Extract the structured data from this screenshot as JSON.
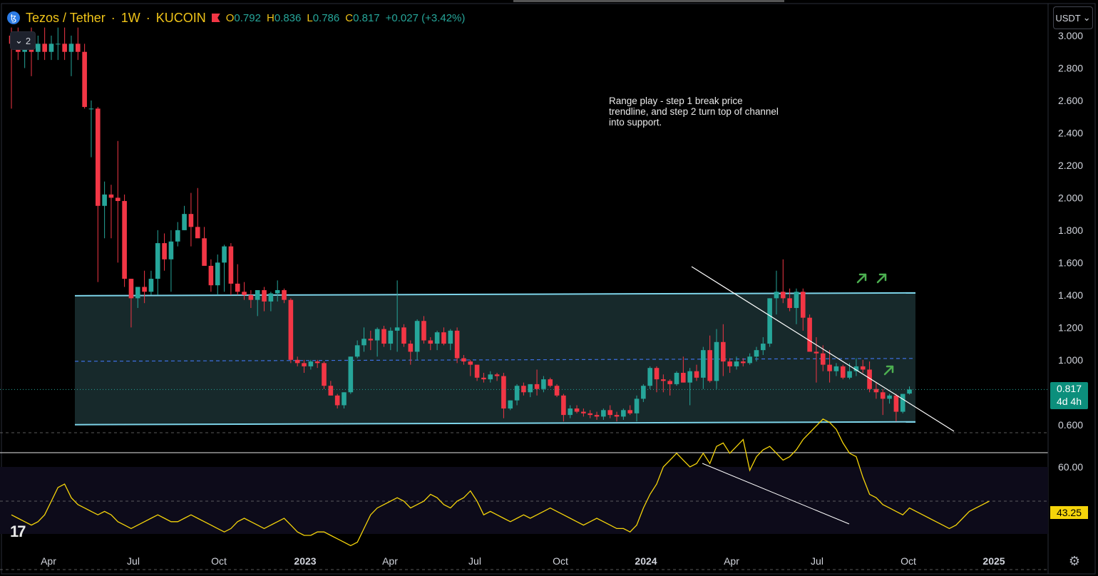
{
  "legend": {
    "symbol": "Tezos / Tether",
    "sep": "·",
    "interval": "1W",
    "exchange": "KUCOIN",
    "o_label": "O",
    "o": "0.792",
    "h_label": "H",
    "h": "0.836",
    "l_label": "L",
    "l": "0.786",
    "c_label": "C",
    "c": "0.817",
    "change": "+0.027 (+3.42%)",
    "collapsed_count": "2"
  },
  "currency": "USDT",
  "last_price": "0.817",
  "countdown": "4d 4h",
  "rsi_value": "43.25",
  "annotation": "Range play - step 1 break price trendline, and step 2 turn top of channel into support.",
  "colors": {
    "up": "#26a69a",
    "down": "#f23645",
    "channel": "#7dd3e8",
    "midline": "#3d6fe0",
    "rsi": "#f5d40a",
    "arrow": "#4caf50"
  },
  "icons": [
    "tezos-logo-icon",
    "flag-icon",
    "chevron-down-icon",
    "tradingview-logo-icon",
    "gear-icon",
    "arrow-up-right-icon"
  ],
  "chart_data": {
    "type": "candlestick",
    "price_axis": {
      "ticks": [
        "3.000",
        "2.800",
        "2.600",
        "2.400",
        "2.200",
        "2.000",
        "1.800",
        "1.600",
        "1.400",
        "1.200",
        "1.000",
        "0.600"
      ],
      "range": [
        0.52,
        3.06
      ]
    },
    "time_axis": {
      "labels": [
        "Apr",
        "Jul",
        "Oct",
        "2023",
        "Apr",
        "Jul",
        "Oct",
        "2024",
        "Apr",
        "Jul",
        "Oct",
        "2025"
      ],
      "start": "2022-01-03",
      "interval_days": 7
    },
    "ohlc": [
      [
        3.0,
        3.05,
        2.55,
        2.95
      ],
      [
        2.95,
        3.05,
        2.85,
        2.9
      ],
      [
        2.9,
        3.0,
        2.8,
        2.95
      ],
      [
        2.95,
        3.05,
        2.75,
        2.9
      ],
      [
        2.9,
        3.0,
        2.85,
        2.95
      ],
      [
        2.95,
        3.05,
        2.85,
        2.9
      ],
      [
        2.9,
        3.0,
        2.85,
        2.95
      ],
      [
        2.95,
        3.05,
        2.85,
        2.95
      ],
      [
        2.95,
        3.05,
        2.85,
        2.9
      ],
      [
        2.9,
        3.0,
        2.75,
        2.95
      ],
      [
        2.95,
        3.05,
        2.85,
        2.9
      ],
      [
        2.9,
        2.95,
        2.55,
        2.56
      ],
      [
        2.55,
        2.6,
        2.25,
        2.55
      ],
      [
        2.55,
        2.56,
        1.48,
        1.95
      ],
      [
        1.95,
        2.1,
        1.75,
        2.02
      ],
      [
        2.02,
        2.08,
        1.75,
        2.0
      ],
      [
        2.0,
        2.35,
        1.6,
        1.98
      ],
      [
        1.98,
        2.02,
        1.45,
        1.5
      ],
      [
        1.5,
        1.5,
        1.2,
        1.38
      ],
      [
        1.38,
        1.45,
        1.32,
        1.45
      ],
      [
        1.45,
        1.55,
        1.35,
        1.42
      ],
      [
        1.42,
        1.55,
        1.4,
        1.5
      ],
      [
        1.5,
        1.8,
        1.4,
        1.72
      ],
      [
        1.72,
        1.78,
        1.55,
        1.62
      ],
      [
        1.62,
        1.8,
        1.42,
        1.73
      ],
      [
        1.73,
        1.85,
        1.7,
        1.8
      ],
      [
        1.8,
        1.95,
        1.8,
        1.9
      ],
      [
        1.9,
        2.03,
        1.7,
        1.82
      ],
      [
        1.82,
        2.06,
        1.76,
        1.75
      ],
      [
        1.75,
        1.82,
        1.6,
        1.58
      ],
      [
        1.58,
        1.62,
        1.42,
        1.46
      ],
      [
        1.46,
        1.65,
        1.4,
        1.6
      ],
      [
        1.6,
        1.71,
        1.42,
        1.7
      ],
      [
        1.7,
        1.72,
        1.4,
        1.47
      ],
      [
        1.47,
        1.59,
        1.4,
        1.42
      ],
      [
        1.42,
        1.48,
        1.37,
        1.4
      ],
      [
        1.4,
        1.43,
        1.32,
        1.37
      ],
      [
        1.37,
        1.42,
        1.27,
        1.43
      ],
      [
        1.43,
        1.45,
        1.3,
        1.36
      ],
      [
        1.36,
        1.42,
        1.3,
        1.41
      ],
      [
        1.41,
        1.49,
        1.36,
        1.43
      ],
      [
        1.43,
        1.44,
        1.35,
        1.37
      ],
      [
        1.37,
        1.38,
        0.98,
        1.0
      ],
      [
        1.0,
        1.02,
        0.96,
        0.98
      ],
      [
        0.98,
        1.0,
        0.92,
        0.96
      ],
      [
        0.96,
        1.0,
        0.94,
        0.99
      ],
      [
        0.99,
        1.0,
        0.95,
        0.98
      ],
      [
        0.98,
        0.99,
        0.82,
        0.84
      ],
      [
        0.84,
        0.87,
        0.78,
        0.78
      ],
      [
        0.78,
        0.79,
        0.7,
        0.72
      ],
      [
        0.72,
        0.8,
        0.7,
        0.8
      ],
      [
        0.8,
        1.02,
        0.79,
        1.02
      ],
      [
        1.02,
        1.12,
        1.01,
        1.09
      ],
      [
        1.09,
        1.2,
        1.05,
        1.13
      ],
      [
        1.13,
        1.18,
        1.06,
        1.12
      ],
      [
        1.12,
        1.2,
        1.02,
        1.19
      ],
      [
        1.19,
        1.21,
        1.08,
        1.1
      ],
      [
        1.1,
        1.2,
        1.06,
        1.18
      ],
      [
        1.18,
        1.49,
        1.05,
        1.2
      ],
      [
        1.2,
        1.22,
        1.08,
        1.1
      ],
      [
        1.1,
        1.12,
        0.97,
        1.05
      ],
      [
        1.05,
        1.25,
        1.0,
        1.24
      ],
      [
        1.24,
        1.27,
        1.1,
        1.12
      ],
      [
        1.12,
        1.14,
        1.06,
        1.1
      ],
      [
        1.1,
        1.18,
        1.06,
        1.17
      ],
      [
        1.17,
        1.2,
        1.09,
        1.1
      ],
      [
        1.1,
        1.19,
        1.06,
        1.18
      ],
      [
        1.18,
        1.2,
        0.98,
        1.01
      ],
      [
        1.01,
        1.03,
        0.97,
        0.99
      ],
      [
        0.99,
        1.0,
        0.9,
        0.97
      ],
      [
        0.97,
        0.97,
        0.87,
        0.89
      ],
      [
        0.89,
        0.92,
        0.86,
        0.88
      ],
      [
        0.88,
        0.93,
        0.86,
        0.91
      ],
      [
        0.91,
        0.92,
        0.87,
        0.9
      ],
      [
        0.9,
        0.92,
        0.64,
        0.7
      ],
      [
        0.7,
        0.75,
        0.69,
        0.75
      ],
      [
        0.75,
        0.85,
        0.72,
        0.84
      ],
      [
        0.84,
        0.86,
        0.78,
        0.8
      ],
      [
        0.8,
        0.85,
        0.77,
        0.85
      ],
      [
        0.85,
        0.94,
        0.78,
        0.82
      ],
      [
        0.82,
        0.9,
        0.8,
        0.88
      ],
      [
        0.88,
        0.89,
        0.83,
        0.84
      ],
      [
        0.84,
        0.85,
        0.77,
        0.78
      ],
      [
        0.78,
        0.79,
        0.62,
        0.66
      ],
      [
        0.66,
        0.72,
        0.64,
        0.7
      ],
      [
        0.7,
        0.72,
        0.67,
        0.68
      ],
      [
        0.68,
        0.7,
        0.65,
        0.67
      ],
      [
        0.67,
        0.69,
        0.64,
        0.66
      ],
      [
        0.66,
        0.68,
        0.63,
        0.65
      ],
      [
        0.65,
        0.7,
        0.63,
        0.69
      ],
      [
        0.69,
        0.72,
        0.64,
        0.66
      ],
      [
        0.66,
        0.68,
        0.62,
        0.65
      ],
      [
        0.65,
        0.7,
        0.63,
        0.69
      ],
      [
        0.69,
        0.72,
        0.66,
        0.67
      ],
      [
        0.67,
        0.78,
        0.62,
        0.76
      ],
      [
        0.76,
        0.85,
        0.74,
        0.84
      ],
      [
        0.84,
        0.96,
        0.82,
        0.95
      ],
      [
        0.95,
        0.96,
        0.8,
        0.88
      ],
      [
        0.88,
        0.91,
        0.8,
        0.87
      ],
      [
        0.87,
        0.88,
        0.78,
        0.85
      ],
      [
        0.85,
        0.93,
        0.84,
        0.92
      ],
      [
        0.92,
        1.02,
        0.86,
        0.86
      ],
      [
        0.86,
        0.95,
        0.72,
        0.93
      ],
      [
        0.93,
        0.97,
        0.87,
        0.89
      ],
      [
        0.89,
        1.08,
        0.82,
        1.06
      ],
      [
        1.06,
        1.15,
        0.86,
        0.87
      ],
      [
        0.87,
        1.19,
        0.82,
        1.11
      ],
      [
        1.11,
        1.22,
        0.9,
        0.99
      ],
      [
        0.99,
        1.01,
        0.92,
        0.96
      ],
      [
        0.96,
        1.02,
        0.94,
        0.99
      ],
      [
        0.99,
        1.01,
        0.96,
        0.98
      ],
      [
        0.98,
        1.04,
        0.97,
        1.02
      ],
      [
        1.02,
        1.08,
        0.99,
        1.06
      ],
      [
        1.06,
        1.14,
        1.03,
        1.1
      ],
      [
        1.1,
        1.38,
        1.08,
        1.38
      ],
      [
        1.38,
        1.55,
        1.28,
        1.42
      ],
      [
        1.42,
        1.62,
        1.35,
        1.38
      ],
      [
        1.38,
        1.44,
        1.3,
        1.32
      ],
      [
        1.32,
        1.44,
        1.22,
        1.42
      ],
      [
        1.42,
        1.44,
        1.18,
        1.26
      ],
      [
        1.26,
        1.28,
        1.08,
        1.05
      ],
      [
        1.05,
        1.14,
        0.86,
        1.04
      ],
      [
        1.04,
        1.09,
        0.93,
        0.97
      ],
      [
        0.97,
        1.06,
        0.86,
        0.93
      ],
      [
        0.93,
        0.98,
        0.9,
        0.96
      ],
      [
        0.96,
        0.97,
        0.88,
        0.89
      ],
      [
        0.89,
        0.98,
        0.88,
        0.93
      ],
      [
        0.93,
        1.01,
        0.9,
        0.96
      ],
      [
        0.96,
        1.0,
        0.92,
        0.94
      ],
      [
        0.94,
        0.99,
        0.8,
        0.82
      ],
      [
        0.82,
        0.86,
        0.76,
        0.8
      ],
      [
        0.8,
        0.82,
        0.66,
        0.76
      ],
      [
        0.76,
        0.79,
        0.73,
        0.78
      ],
      [
        0.78,
        0.79,
        0.62,
        0.68
      ],
      [
        0.68,
        0.79,
        0.67,
        0.79
      ],
      [
        0.792,
        0.836,
        0.786,
        0.817
      ]
    ],
    "channel": {
      "top": 1.4,
      "bottom": 0.6,
      "mid": 1.0
    },
    "rsi": {
      "levels": [
        "60.00",
        "43.25"
      ],
      "values": [
        46,
        45,
        44,
        43,
        44,
        46,
        50,
        54,
        55,
        51,
        49,
        48,
        47,
        46,
        47,
        46,
        44,
        43,
        42,
        43,
        44,
        45,
        46,
        45,
        44,
        44,
        45,
        46,
        45,
        44,
        43,
        42,
        41,
        42,
        44,
        45,
        44,
        43,
        42,
        43,
        44,
        45,
        43,
        41,
        40,
        40,
        41,
        41,
        40,
        39,
        38,
        37,
        38,
        42,
        46,
        48,
        49,
        50,
        51,
        50,
        48,
        49,
        50,
        52,
        51,
        49,
        48,
        50,
        51,
        53,
        50,
        46,
        47,
        46,
        45,
        44,
        45,
        46,
        45,
        46,
        47,
        48,
        47,
        46,
        45,
        44,
        43,
        44,
        45,
        44,
        43,
        42,
        42,
        41,
        43,
        48,
        52,
        55,
        60,
        62,
        64,
        62,
        60,
        61,
        64,
        61,
        66,
        67,
        64,
        66,
        68,
        59,
        63,
        65,
        66,
        64,
        62,
        63,
        65,
        68,
        70,
        72,
        74,
        73,
        71,
        67,
        64,
        63,
        57,
        52,
        51,
        49,
        48,
        47,
        46,
        48,
        47,
        46,
        45,
        44,
        43,
        42,
        43,
        45,
        47,
        48,
        49,
        50
      ]
    }
  }
}
